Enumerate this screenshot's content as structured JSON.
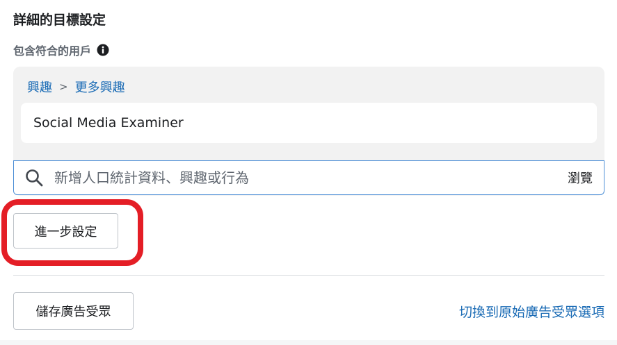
{
  "section": {
    "title": "詳細的目標設定",
    "include_label": "包含符合的用戶"
  },
  "icons": {
    "info": "info-icon",
    "search": "search-icon"
  },
  "breadcrumb": {
    "parent": "興趣",
    "separator": ">",
    "current": "更多興趣"
  },
  "selected_interest": "Social Media Examiner",
  "search": {
    "value": "",
    "placeholder": "新增人口統計資料、興趣或行為",
    "browse_label": "瀏覽"
  },
  "buttons": {
    "advanced": "進一步設定",
    "save_audience": "儲存廣告受眾"
  },
  "links": {
    "switch_audience": "切換到原始廣告受眾選項"
  },
  "colors": {
    "link": "#1a6bb5",
    "highlight": "#e41e26",
    "panel_bg": "#f2f2f2",
    "search_border": "#4d8fd6"
  }
}
